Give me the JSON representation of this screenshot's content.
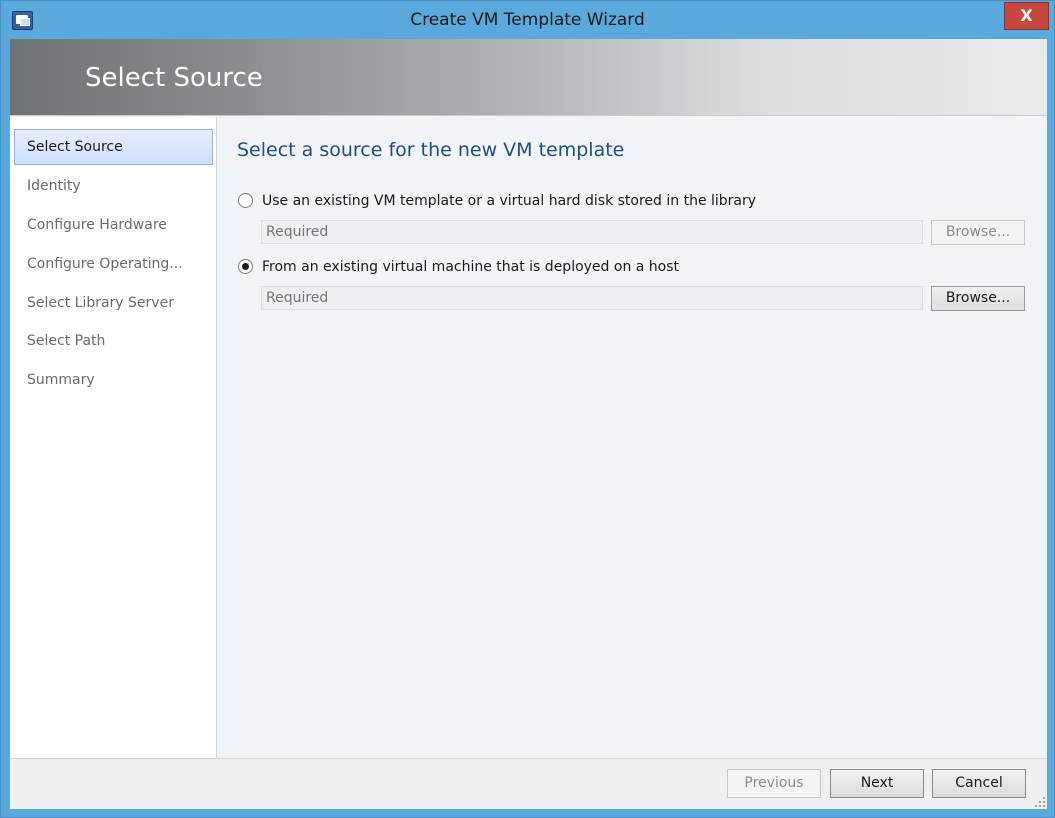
{
  "window": {
    "title": "Create VM Template Wizard",
    "close_glyph": "X",
    "app_icon": "vmm-console-icon"
  },
  "banner": {
    "title": "Select Source"
  },
  "nav": {
    "items": [
      {
        "label": "Select Source",
        "selected": true
      },
      {
        "label": "Identity",
        "selected": false
      },
      {
        "label": "Configure Hardware",
        "selected": false
      },
      {
        "label": "Configure Operating...",
        "selected": false
      },
      {
        "label": "Select Library Server",
        "selected": false
      },
      {
        "label": "Select Path",
        "selected": false
      },
      {
        "label": "Summary",
        "selected": false
      }
    ]
  },
  "main": {
    "heading": "Select a source for the new VM template",
    "options": [
      {
        "label": "Use an existing VM template or a virtual hard disk stored in the library",
        "checked": false,
        "field_placeholder": "Required",
        "browse_label": "Browse...",
        "browse_enabled": false
      },
      {
        "label": "From an existing virtual machine that is deployed on a host",
        "checked": true,
        "field_placeholder": "Required",
        "browse_label": "Browse...",
        "browse_enabled": true
      }
    ]
  },
  "footer": {
    "previous_label": "Previous",
    "previous_enabled": false,
    "next_label": "Next",
    "cancel_label": "Cancel"
  },
  "colors": {
    "window_frame": "#5aa9dc",
    "heading_blue": "#1e4c8a",
    "close_red": "#c7483e",
    "nav_selected": "#cfe0fb"
  }
}
